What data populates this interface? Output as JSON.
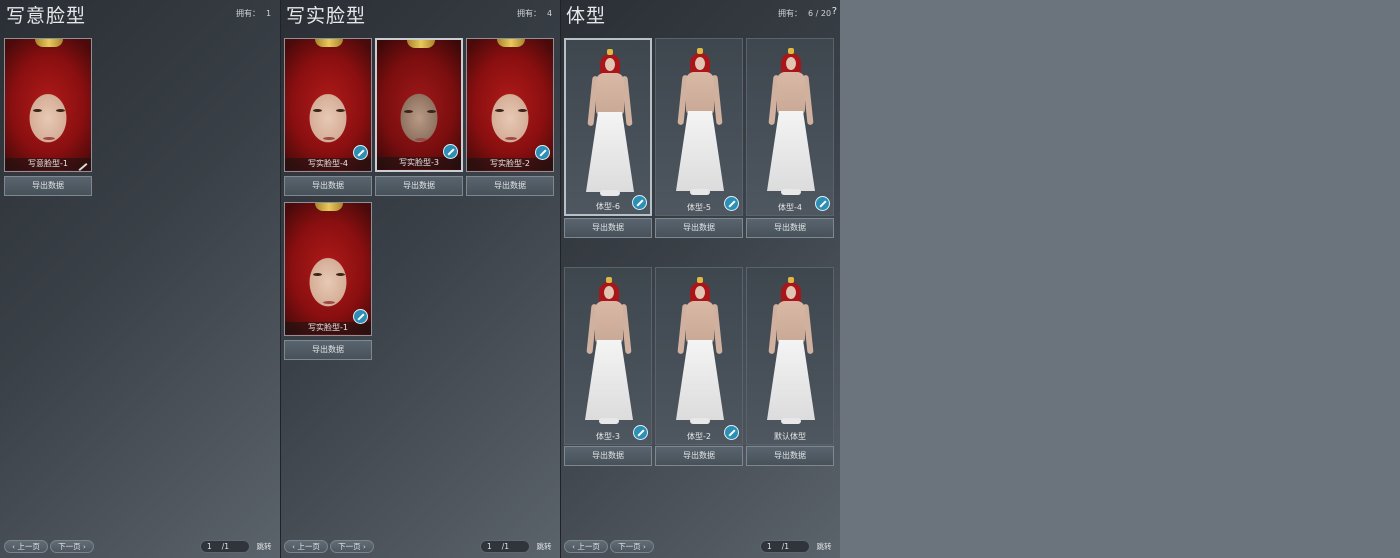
{
  "panels": [
    {
      "title": "写意脸型",
      "owned_label": "拥有：",
      "owned_value": "1",
      "cards": [
        {
          "label": "写意脸型-1",
          "button": "导出数据"
        }
      ]
    },
    {
      "title": "写实脸型",
      "owned_label": "拥有：",
      "owned_value": "4",
      "cards": [
        {
          "label": "写实脸型-4",
          "button": "导出数据"
        },
        {
          "label": "写实脸型-3",
          "button": "导出数据"
        },
        {
          "label": "写实脸型-2",
          "button": "导出数据"
        },
        {
          "label": "写实脸型-1",
          "button": "导出数据"
        }
      ]
    },
    {
      "title": "体型",
      "owned_label": "拥有：",
      "owned_value": "6 / 20",
      "help": "?",
      "cards": [
        {
          "label": "体型-6",
          "button": "导出数据"
        },
        {
          "label": "体型-5",
          "button": "导出数据"
        },
        {
          "label": "体型-4",
          "button": "导出数据"
        },
        {
          "label": "体型-3",
          "button": "导出数据"
        },
        {
          "label": "体型-2",
          "button": "导出数据"
        },
        {
          "label": "默认体型",
          "button": "导出数据"
        }
      ]
    }
  ],
  "pager": {
    "prev": "上一页",
    "next": "下一页",
    "current": "1",
    "total": "/1",
    "goto": "跳转"
  },
  "icons": {
    "edit_badge": "brush-icon",
    "edit_pen": "pen-icon",
    "prev_arrow": "‹",
    "next_arrow": "›"
  }
}
